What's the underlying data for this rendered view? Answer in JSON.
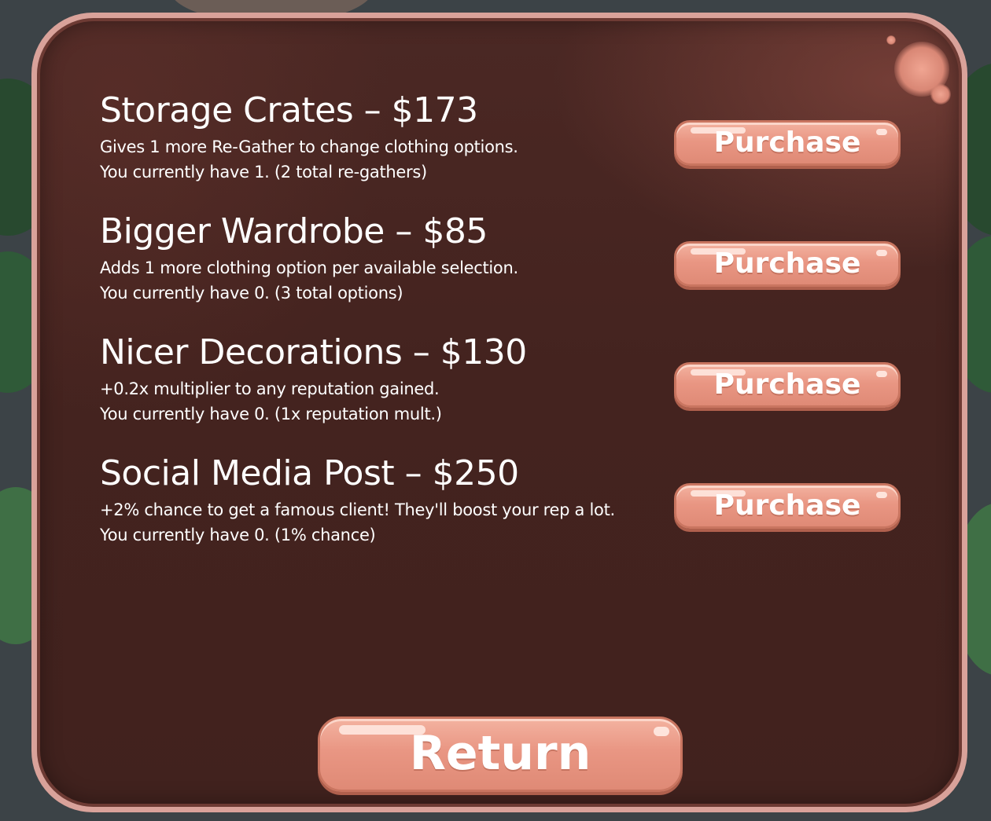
{
  "upgrades": [
    {
      "title": "Storage Crates – $173",
      "desc_line1": "Gives 1 more Re-Gather to change clothing options.",
      "desc_line2": "You currently have 1. (2 total re-gathers)",
      "button_label": "Purchase"
    },
    {
      "title": "Bigger Wardrobe – $85",
      "desc_line1": "Adds 1 more clothing option per available selection.",
      "desc_line2": "You currently have 0. (3 total options)",
      "button_label": "Purchase"
    },
    {
      "title": "Nicer Decorations – $130",
      "desc_line1": "+0.2x multiplier to any reputation gained.",
      "desc_line2": "You currently have 0. (1x reputation mult.)",
      "button_label": "Purchase"
    },
    {
      "title": "Social Media Post – $250",
      "desc_line1": "+2% chance to get a famous client! They'll boost your rep a lot.",
      "desc_line2": "You currently have 0. (1% chance)",
      "button_label": "Purchase"
    }
  ],
  "return_button": {
    "label": "Return"
  },
  "colors": {
    "panel_bg": "#44231f",
    "panel_border": "#d9a29a",
    "button_fill": "#e99683",
    "text": "#ffffff"
  }
}
